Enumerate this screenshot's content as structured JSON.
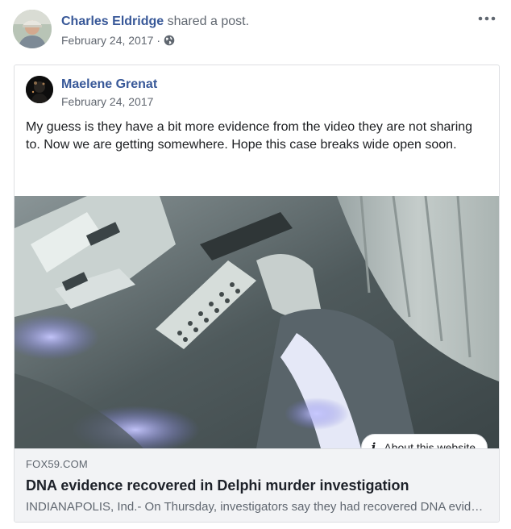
{
  "post": {
    "poster_name": "Charles Eldridge",
    "action_text": "shared a post.",
    "date": "February 24, 2017",
    "separator": "·",
    "audience_icon": "globe-icon",
    "more_icon": "more-options-icon"
  },
  "shared_post": {
    "author_name": "Maelene Grenat",
    "date": "February 24, 2017",
    "text": "My guess is they have a bit more evidence from the video they are not sharing to. Now we are getting somewhere. Hope this case breaks wide open soon."
  },
  "link_preview": {
    "about_label": "About this website",
    "about_icon": "info-icon",
    "domain": "FOX59.COM",
    "title": "DNA evidence recovered in Delphi murder investigation",
    "description": "INDIANAPOLIS, Ind.- On Thursday, investigators say they had recovered DNA evidence…"
  },
  "colors": {
    "name_link": "#385898",
    "secondary_text": "#606770",
    "card_border": "#dddfe2",
    "meta_background": "#f2f3f5"
  }
}
